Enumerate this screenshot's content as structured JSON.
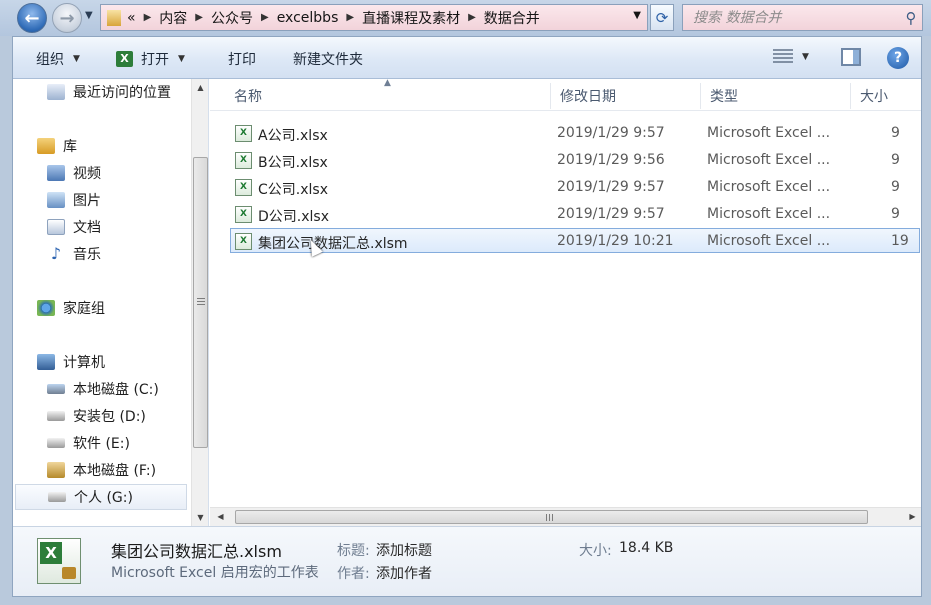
{
  "address_bar": {
    "overflow": "«",
    "crumbs": [
      "内容",
      "公众号",
      "excelbbs",
      "直播课程及素材",
      "数据合并"
    ]
  },
  "search": {
    "placeholder": "搜索 数据合并"
  },
  "toolbar": {
    "organize": "组织",
    "open": "打开",
    "print": "打印",
    "new_folder": "新建文件夹"
  },
  "nav": {
    "recent": "最近访问的位置",
    "library": "库",
    "videos": "视频",
    "pictures": "图片",
    "documents": "文档",
    "music": "音乐",
    "homegroup": "家庭组",
    "computer": "计算机",
    "drives": [
      "本地磁盘 (C:)",
      "安装包 (D:)",
      "软件 (E:)",
      "本地磁盘 (F:)",
      "个人 (G:)"
    ]
  },
  "columns": {
    "name": "名称",
    "modified": "修改日期",
    "type": "类型",
    "size": "大小"
  },
  "files": [
    {
      "name": "A公司.xlsx",
      "date": "2019/1/29 9:57",
      "type": "Microsoft Excel ...",
      "size": "9"
    },
    {
      "name": "B公司.xlsx",
      "date": "2019/1/29 9:56",
      "type": "Microsoft Excel ...",
      "size": "9"
    },
    {
      "name": "C公司.xlsx",
      "date": "2019/1/29 9:57",
      "type": "Microsoft Excel ...",
      "size": "9"
    },
    {
      "name": "D公司.xlsx",
      "date": "2019/1/29 9:57",
      "type": "Microsoft Excel ...",
      "size": "9"
    },
    {
      "name": "集团公司数据汇总.xlsm",
      "date": "2019/1/29 10:21",
      "type": "Microsoft Excel ...",
      "size": "19"
    }
  ],
  "details": {
    "name": "集团公司数据汇总.xlsm",
    "type": "Microsoft Excel 启用宏的工作表",
    "title_label": "标题:",
    "title_value": "添加标题",
    "author_label": "作者:",
    "author_value": "添加作者",
    "size_label": "大小:",
    "size_value": "18.4 KB"
  }
}
